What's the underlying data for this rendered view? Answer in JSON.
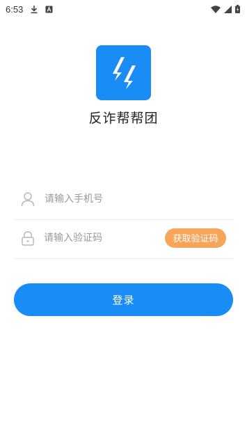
{
  "status_bar": {
    "time": "6:53",
    "icons": [
      "download-icon",
      "accessibility-a-icon",
      "wifi-icon",
      "signal-icon",
      "battery-icon"
    ]
  },
  "app": {
    "logo_icon": "lightning-logo-icon",
    "name": "反诈帮帮团",
    "brand_color": "#1a8cf6"
  },
  "form": {
    "phone": {
      "icon": "user-icon",
      "placeholder": "请输入手机号",
      "value": ""
    },
    "code": {
      "icon": "lock-icon",
      "placeholder": "请输入验证码",
      "value": "",
      "get_code_label": "获取验证码",
      "get_code_color": "#f7a55b"
    },
    "login_label": "登录"
  }
}
